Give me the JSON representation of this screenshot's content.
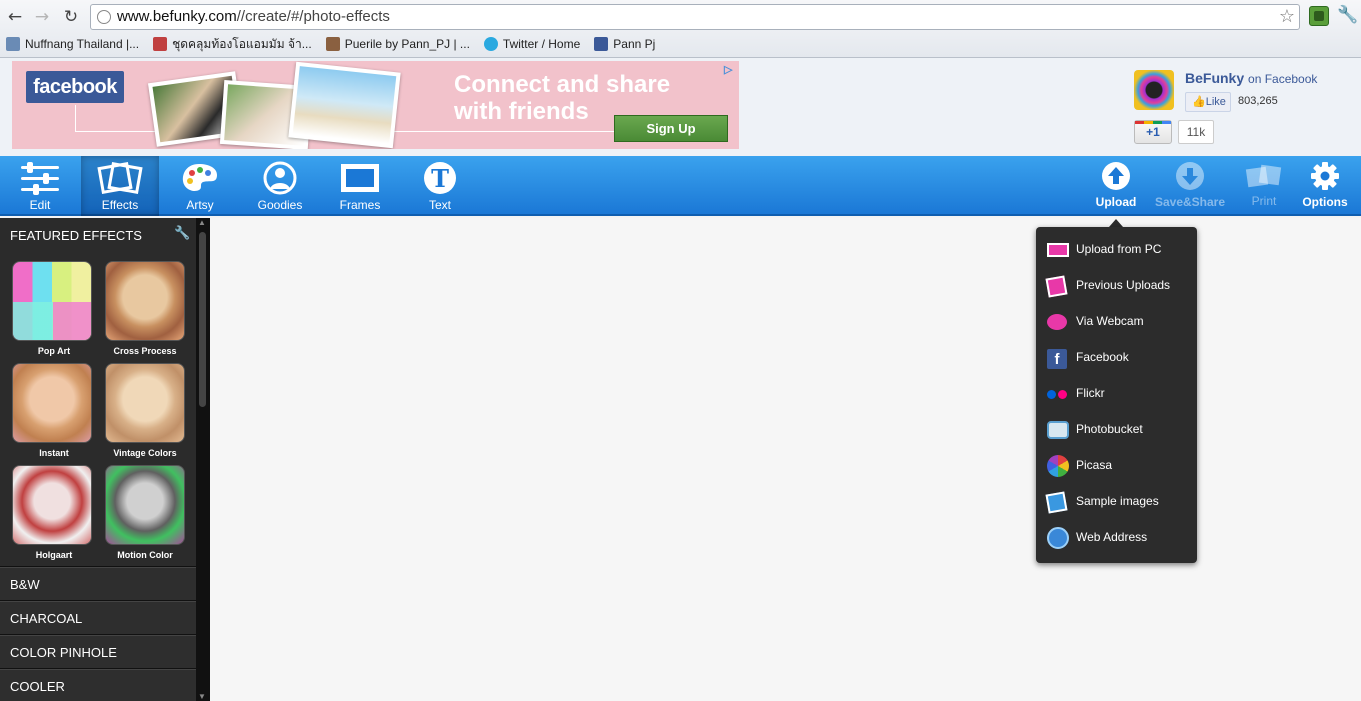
{
  "browser": {
    "url_host": "www.befunky.com",
    "url_path": "//create/#/photo-effects",
    "bookmarks": [
      {
        "label": "Nuffnang Thailand |...",
        "color": "#6a8bb5"
      },
      {
        "label": "ชุดคลุมท้องโอแอมมัม จ้า...",
        "color": "#c04040"
      },
      {
        "label": "Puerile by Pann_PJ | ...",
        "color": "#8a6040"
      },
      {
        "label": "Twitter / Home",
        "color": "#2aa9e0"
      },
      {
        "label": "Pann Pj",
        "color": "#3b5998"
      }
    ]
  },
  "ad": {
    "logo": "facebook",
    "headline": "Connect and share with friends",
    "cta": "Sign Up"
  },
  "befunky_widget": {
    "name": "BeFunky",
    "on_facebook": "on Facebook",
    "like_label": "Like",
    "like_count": "803,265",
    "plusone_label": "+1",
    "plusone_count": "11k"
  },
  "toolbar": {
    "left_tools": [
      {
        "label": "Edit",
        "icon": "sliders-icon"
      },
      {
        "label": "Effects",
        "icon": "effects-icon",
        "active": true
      },
      {
        "label": "Artsy",
        "icon": "palette-icon"
      },
      {
        "label": "Goodies",
        "icon": "goodies-icon"
      },
      {
        "label": "Frames",
        "icon": "frame-icon"
      },
      {
        "label": "Text",
        "icon": "text-icon"
      }
    ],
    "right_tools": [
      {
        "label": "Upload",
        "icon": "upload-icon"
      },
      {
        "label": "Save&Share",
        "icon": "download-icon",
        "disabled": true
      },
      {
        "label": "Print",
        "icon": "print-icon",
        "disabled": true
      },
      {
        "label": "Options",
        "icon": "gear-icon"
      }
    ]
  },
  "sidebar": {
    "featured_title": "FEATURED EFFECTS",
    "effects": [
      {
        "label": "Pop Art"
      },
      {
        "label": "Cross Process"
      },
      {
        "label": "Instant"
      },
      {
        "label": "Vintage Colors"
      },
      {
        "label": "Holgaart"
      },
      {
        "label": "Motion Color"
      }
    ],
    "categories": [
      "B&W",
      "CHARCOAL",
      "COLOR PINHOLE",
      "COOLER"
    ]
  },
  "upload_menu": {
    "items": [
      {
        "label": "Upload from PC",
        "icon": "pc-icon"
      },
      {
        "label": "Previous Uploads",
        "icon": "previous-uploads-icon"
      },
      {
        "label": "Via Webcam",
        "icon": "webcam-icon"
      },
      {
        "label": "Facebook",
        "icon": "facebook-icon"
      },
      {
        "label": "Flickr",
        "icon": "flickr-icon"
      },
      {
        "label": "Photobucket",
        "icon": "photobucket-icon"
      },
      {
        "label": "Picasa",
        "icon": "picasa-icon"
      },
      {
        "label": "Sample images",
        "icon": "sample-images-icon"
      },
      {
        "label": "Web Address",
        "icon": "web-address-icon"
      }
    ]
  }
}
